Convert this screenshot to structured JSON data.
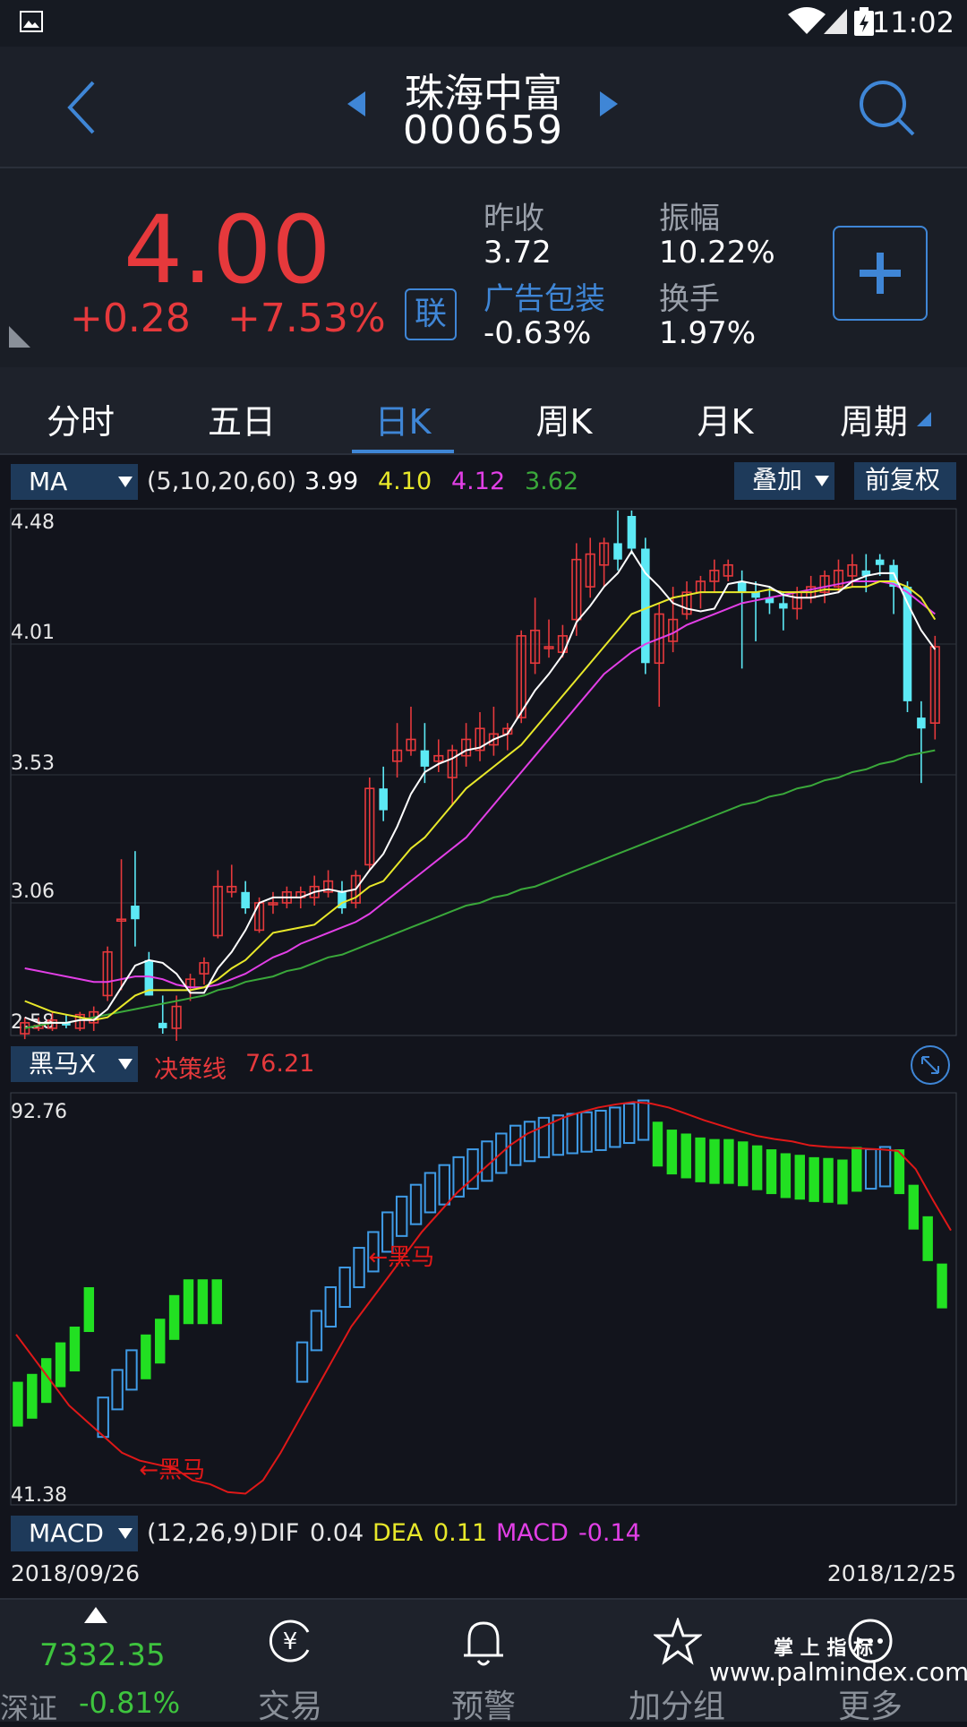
{
  "status": {
    "time": "11:02"
  },
  "header": {
    "stock_name": "珠海中富",
    "stock_code": "000659"
  },
  "quote": {
    "price": "4.00",
    "change": "+0.28",
    "change_pct": "+7.53%",
    "lian_label": "联",
    "prev_close_label": "昨收",
    "prev_close": "3.72",
    "amplitude_label": "振幅",
    "amplitude": "10.22%",
    "sector_label": "广告包装",
    "sector_change": "-0.63%",
    "turnover_label": "换手",
    "turnover": "1.97%"
  },
  "tabs": [
    "分时",
    "五日",
    "日K",
    "周K",
    "月K",
    "周期"
  ],
  "active_tab": "日K",
  "ma_bar": {
    "selector": "MA",
    "params": "(5,10,20,60)",
    "ma5": "3.99",
    "ma10": "4.10",
    "ma20": "4.12",
    "ma60": "3.62",
    "overlay_button": "叠加",
    "adjust_button": "前复权"
  },
  "colors": {
    "up": "#e6393c",
    "down": "#5ce9f5",
    "ma5": "#ffffff",
    "ma10": "#e8e82a",
    "ma20": "#e23fe6",
    "ma60": "#3aa83a",
    "accent": "#3f86d6"
  },
  "indicator2": {
    "selector": "黑马X",
    "label": "决策线",
    "value": "76.21",
    "signal_text": "←黑马"
  },
  "macd_bar": {
    "selector": "MACD",
    "params": "(12,26,9)",
    "dif_label": "DIF",
    "dif": "0.04",
    "dea_label": "DEA",
    "dea": "0.11",
    "macd_label": "MACD",
    "macd": "-0.14"
  },
  "dates": {
    "start": "2018/09/26",
    "end": "2018/12/25"
  },
  "nav": {
    "index_value": "7332.35",
    "index_name": "深证",
    "index_change": "-0.81%",
    "items": [
      "交易",
      "预警",
      "加分组",
      "更多"
    ]
  },
  "watermark": {
    "line1": "掌 上 指 标",
    "line2": "www.palmindex.com"
  },
  "chart_data": [
    {
      "type": "candlestick",
      "ytick_labels": [
        "4.48",
        "4.01",
        "3.53",
        "3.06",
        "2.58"
      ],
      "ylim": [
        2.58,
        4.48
      ],
      "candles": [
        {
          "o": 2.58,
          "h": 2.64,
          "l": 2.56,
          "c": 2.62
        },
        {
          "o": 2.6,
          "h": 2.64,
          "l": 2.59,
          "c": 2.61
        },
        {
          "o": 2.6,
          "h": 2.66,
          "l": 2.59,
          "c": 2.63
        },
        {
          "o": 2.62,
          "h": 2.65,
          "l": 2.6,
          "c": 2.61
        },
        {
          "o": 2.6,
          "h": 2.66,
          "l": 2.59,
          "c": 2.65
        },
        {
          "o": 2.62,
          "h": 2.68,
          "l": 2.59,
          "c": 2.66
        },
        {
          "o": 2.72,
          "h": 2.9,
          "l": 2.7,
          "c": 2.88
        },
        {
          "o": 3.0,
          "h": 3.22,
          "l": 2.74,
          "c": 3.0
        },
        {
          "o": 3.05,
          "h": 3.25,
          "l": 2.9,
          "c": 3.0
        },
        {
          "o": 2.85,
          "h": 2.88,
          "l": 2.72,
          "c": 2.72
        },
        {
          "o": 2.62,
          "h": 2.72,
          "l": 2.58,
          "c": 2.6
        },
        {
          "o": 2.6,
          "h": 2.72,
          "l": 2.55,
          "c": 2.68
        },
        {
          "o": 2.75,
          "h": 2.8,
          "l": 2.7,
          "c": 2.78
        },
        {
          "o": 2.8,
          "h": 2.86,
          "l": 2.76,
          "c": 2.84
        },
        {
          "o": 2.94,
          "h": 3.18,
          "l": 2.93,
          "c": 3.12
        },
        {
          "o": 3.1,
          "h": 3.2,
          "l": 3.08,
          "c": 3.12
        },
        {
          "o": 3.1,
          "h": 3.14,
          "l": 3.02,
          "c": 3.04
        },
        {
          "o": 2.96,
          "h": 3.08,
          "l": 2.95,
          "c": 3.06
        },
        {
          "o": 3.06,
          "h": 3.1,
          "l": 3.02,
          "c": 3.06
        },
        {
          "o": 3.06,
          "h": 3.12,
          "l": 3.04,
          "c": 3.1
        },
        {
          "o": 3.08,
          "h": 3.12,
          "l": 3.04,
          "c": 3.1
        },
        {
          "o": 3.08,
          "h": 3.16,
          "l": 3.05,
          "c": 3.12
        },
        {
          "o": 3.1,
          "h": 3.18,
          "l": 3.08,
          "c": 3.14
        },
        {
          "o": 3.1,
          "h": 3.14,
          "l": 3.02,
          "c": 3.04
        },
        {
          "o": 3.06,
          "h": 3.18,
          "l": 3.04,
          "c": 3.16
        },
        {
          "o": 3.2,
          "h": 3.52,
          "l": 3.18,
          "c": 3.48
        },
        {
          "o": 3.48,
          "h": 3.56,
          "l": 3.36,
          "c": 3.4
        },
        {
          "o": 3.58,
          "h": 3.72,
          "l": 3.52,
          "c": 3.62
        },
        {
          "o": 3.62,
          "h": 3.78,
          "l": 3.6,
          "c": 3.66
        },
        {
          "o": 3.62,
          "h": 3.72,
          "l": 3.5,
          "c": 3.56
        },
        {
          "o": 3.58,
          "h": 3.66,
          "l": 3.54,
          "c": 3.6
        },
        {
          "o": 3.52,
          "h": 3.64,
          "l": 3.42,
          "c": 3.62
        },
        {
          "o": 3.6,
          "h": 3.72,
          "l": 3.56,
          "c": 3.66
        },
        {
          "o": 3.62,
          "h": 3.76,
          "l": 3.58,
          "c": 3.7
        },
        {
          "o": 3.64,
          "h": 3.78,
          "l": 3.6,
          "c": 3.68
        },
        {
          "o": 3.68,
          "h": 3.72,
          "l": 3.62,
          "c": 3.7
        },
        {
          "o": 3.74,
          "h": 4.06,
          "l": 3.72,
          "c": 4.04
        },
        {
          "o": 3.94,
          "h": 4.18,
          "l": 3.9,
          "c": 4.06
        },
        {
          "o": 4.0,
          "h": 4.1,
          "l": 3.96,
          "c": 4.0
        },
        {
          "o": 3.98,
          "h": 4.08,
          "l": 3.96,
          "c": 4.04
        },
        {
          "o": 4.1,
          "h": 4.38,
          "l": 4.04,
          "c": 4.32
        },
        {
          "o": 4.22,
          "h": 4.4,
          "l": 4.18,
          "c": 4.34
        },
        {
          "o": 4.3,
          "h": 4.4,
          "l": 4.22,
          "c": 4.38
        },
        {
          "o": 4.38,
          "h": 4.5,
          "l": 4.28,
          "c": 4.32
        },
        {
          "o": 4.48,
          "h": 4.5,
          "l": 4.34,
          "c": 4.36
        },
        {
          "o": 4.36,
          "h": 4.4,
          "l": 3.9,
          "c": 3.94
        },
        {
          "o": 3.94,
          "h": 4.16,
          "l": 3.78,
          "c": 4.12
        },
        {
          "o": 4.02,
          "h": 4.22,
          "l": 3.98,
          "c": 4.1
        },
        {
          "o": 4.12,
          "h": 4.24,
          "l": 4.1,
          "c": 4.2
        },
        {
          "o": 4.2,
          "h": 4.26,
          "l": 4.14,
          "c": 4.24
        },
        {
          "o": 4.24,
          "h": 4.32,
          "l": 4.2,
          "c": 4.28
        },
        {
          "o": 4.26,
          "h": 4.32,
          "l": 4.24,
          "c": 4.3
        },
        {
          "o": 4.24,
          "h": 4.28,
          "l": 3.92,
          "c": 4.2
        },
        {
          "o": 4.2,
          "h": 4.24,
          "l": 4.02,
          "c": 4.18
        },
        {
          "o": 4.18,
          "h": 4.22,
          "l": 4.12,
          "c": 4.16
        },
        {
          "o": 4.16,
          "h": 4.2,
          "l": 4.06,
          "c": 4.14
        },
        {
          "o": 4.14,
          "h": 4.22,
          "l": 4.1,
          "c": 4.2
        },
        {
          "o": 4.18,
          "h": 4.26,
          "l": 4.16,
          "c": 4.22
        },
        {
          "o": 4.2,
          "h": 4.28,
          "l": 4.16,
          "c": 4.26
        },
        {
          "o": 4.22,
          "h": 4.32,
          "l": 4.2,
          "c": 4.28
        },
        {
          "o": 4.26,
          "h": 4.34,
          "l": 4.22,
          "c": 4.3
        },
        {
          "o": 4.28,
          "h": 4.34,
          "l": 4.2,
          "c": 4.26
        },
        {
          "o": 4.32,
          "h": 4.34,
          "l": 4.26,
          "c": 4.3
        },
        {
          "o": 4.3,
          "h": 4.32,
          "l": 4.12,
          "c": 4.22
        },
        {
          "o": 4.22,
          "h": 4.24,
          "l": 3.76,
          "c": 3.8
        },
        {
          "o": 3.74,
          "h": 3.8,
          "l": 3.5,
          "c": 3.7
        },
        {
          "o": 3.72,
          "h": 4.04,
          "l": 3.66,
          "c": 4.0
        }
      ],
      "ma5": [
        2.64,
        2.62,
        2.62,
        2.62,
        2.63,
        2.63,
        2.67,
        2.75,
        2.83,
        2.85,
        2.84,
        2.8,
        2.73,
        2.73,
        2.82,
        2.88,
        2.96,
        3.06,
        3.08,
        3.08,
        3.08,
        3.1,
        3.11,
        3.1,
        3.11,
        3.18,
        3.24,
        3.34,
        3.46,
        3.54,
        3.57,
        3.59,
        3.62,
        3.63,
        3.66,
        3.68,
        3.76,
        3.84,
        3.9,
        3.97,
        4.09,
        4.15,
        4.22,
        4.27,
        4.35,
        4.27,
        4.22,
        4.16,
        4.14,
        4.13,
        4.14,
        4.23,
        4.24,
        4.23,
        4.22,
        4.19,
        4.18,
        4.18,
        4.19,
        4.2,
        4.24,
        4.26,
        4.27,
        4.27,
        4.16,
        4.06,
        3.99
      ],
      "ma10": [
        2.7,
        2.68,
        2.66,
        2.65,
        2.64,
        2.63,
        2.64,
        2.68,
        2.72,
        2.74,
        2.74,
        2.74,
        2.74,
        2.75,
        2.78,
        2.82,
        2.85,
        2.9,
        2.95,
        2.96,
        2.97,
        2.98,
        3.02,
        3.06,
        3.08,
        3.12,
        3.14,
        3.2,
        3.26,
        3.3,
        3.36,
        3.42,
        3.48,
        3.52,
        3.56,
        3.6,
        3.64,
        3.7,
        3.76,
        3.82,
        3.88,
        3.94,
        4.0,
        4.06,
        4.12,
        4.14,
        4.16,
        4.18,
        4.19,
        4.2,
        4.2,
        4.2,
        4.2,
        4.2,
        4.21,
        4.2,
        4.2,
        4.2,
        4.21,
        4.21,
        4.22,
        4.22,
        4.24,
        4.24,
        4.22,
        4.18,
        4.1
      ],
      "ma20": [
        2.82,
        2.81,
        2.8,
        2.79,
        2.78,
        2.77,
        2.77,
        2.78,
        2.79,
        2.79,
        2.78,
        2.76,
        2.75,
        2.75,
        2.76,
        2.78,
        2.8,
        2.83,
        2.86,
        2.88,
        2.91,
        2.93,
        2.95,
        2.97,
        2.99,
        3.02,
        3.06,
        3.1,
        3.14,
        3.18,
        3.22,
        3.26,
        3.3,
        3.36,
        3.42,
        3.48,
        3.54,
        3.6,
        3.66,
        3.72,
        3.78,
        3.84,
        3.9,
        3.94,
        3.98,
        4.01,
        4.03,
        4.05,
        4.08,
        4.1,
        4.12,
        4.14,
        4.16,
        4.17,
        4.18,
        4.19,
        4.2,
        4.21,
        4.22,
        4.23,
        4.24,
        4.24,
        4.24,
        4.23,
        4.2,
        4.16,
        4.12
      ],
      "ma60": [
        2.6,
        2.61,
        2.62,
        2.62,
        2.63,
        2.64,
        2.65,
        2.66,
        2.67,
        2.68,
        2.69,
        2.7,
        2.71,
        2.72,
        2.74,
        2.75,
        2.77,
        2.78,
        2.79,
        2.81,
        2.82,
        2.84,
        2.86,
        2.87,
        2.89,
        2.91,
        2.93,
        2.95,
        2.97,
        2.99,
        3.01,
        3.03,
        3.05,
        3.06,
        3.08,
        3.09,
        3.11,
        3.12,
        3.14,
        3.16,
        3.18,
        3.2,
        3.22,
        3.24,
        3.26,
        3.28,
        3.3,
        3.32,
        3.34,
        3.36,
        3.38,
        3.4,
        3.42,
        3.43,
        3.45,
        3.46,
        3.48,
        3.49,
        3.51,
        3.52,
        3.54,
        3.55,
        3.57,
        3.58,
        3.6,
        3.61,
        3.62
      ]
    },
    {
      "type": "bar",
      "ytick_labels": [
        "92.76",
        "41.38"
      ],
      "ylim": [
        41.38,
        92.76
      ],
      "up_values": [
        null,
        null,
        null,
        null,
        null,
        null,
        55.0,
        58.5,
        61.0,
        null,
        null,
        null,
        null,
        null,
        null,
        null,
        null,
        null,
        null,
        null,
        62.0,
        66.0,
        69.0,
        71.5,
        74.0,
        76.0,
        78.5,
        80.5,
        82.0,
        83.5,
        84.5,
        85.5,
        86.5,
        87.5,
        88.5,
        89.5,
        90.0,
        90.5,
        90.8,
        91.0,
        91.2,
        91.4,
        91.8,
        92.3,
        92.7,
        null,
        null,
        null,
        null,
        null,
        null,
        null,
        null,
        null,
        null,
        null,
        null,
        null,
        null,
        null,
        86.5,
        86.8,
        null
      ],
      "down_values": [
        57,
        58,
        60,
        62,
        64,
        69,
        null,
        null,
        null,
        63,
        65,
        68,
        70,
        70,
        70,
        null,
        null,
        null,
        null,
        null,
        null,
        null,
        null,
        null,
        null,
        null,
        null,
        null,
        null,
        null,
        null,
        null,
        null,
        null,
        null,
        null,
        null,
        null,
        null,
        null,
        null,
        null,
        null,
        null,
        null,
        90.0,
        89.0,
        88.5,
        88.0,
        87.8,
        87.8,
        87.5,
        87.0,
        86.5,
        86.0,
        85.8,
        85.5,
        85.4,
        85.2,
        86.8,
        null,
        null,
        86.5,
        82.0,
        78.0,
        72.0
      ],
      "decision_line": [
        63,
        60,
        57,
        54,
        52,
        50,
        48,
        47,
        46.5,
        46,
        44.5,
        44,
        43,
        42.8,
        44.5,
        48,
        52,
        56,
        60,
        64,
        67,
        70,
        73,
        76,
        78.5,
        81,
        83,
        85,
        87,
        88.5,
        89.5,
        90.5,
        91.2,
        91.8,
        92.2,
        92.5,
        92.3,
        91.8,
        91.0,
        90.2,
        89.5,
        88.8,
        88.2,
        87.8,
        87.5,
        87.0,
        86.8,
        86.7,
        86.6,
        86.5,
        86.3,
        84.0,
        80.0,
        76.21
      ],
      "signals": [
        {
          "index": 9,
          "text": "←黑马"
        },
        {
          "index": 22,
          "text": "←黑马"
        }
      ]
    }
  ]
}
